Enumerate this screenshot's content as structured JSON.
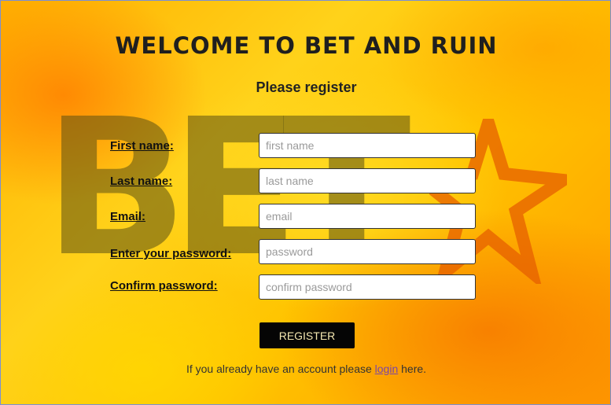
{
  "page": {
    "title": "WELCOME TO BET AND RUIN",
    "subtitle": "Please register",
    "watermark_text": "BET"
  },
  "form": {
    "fields": [
      {
        "label": "First name:",
        "placeholder": "first name",
        "value": ""
      },
      {
        "label": "Last name:",
        "placeholder": "last name",
        "value": ""
      },
      {
        "label": "Email:",
        "placeholder": "email",
        "value": ""
      },
      {
        "label": "Enter your password:",
        "placeholder": "password",
        "value": ""
      },
      {
        "label": "Confirm password:",
        "placeholder": "confirm password",
        "value": ""
      }
    ],
    "submit_label": "REGISTER"
  },
  "footer": {
    "prefix": "If you already have an account please ",
    "link": "login",
    "suffix": " here."
  },
  "colors": {
    "background_primary": "#ffc400",
    "background_accent": "#ff9a00",
    "button_bg": "#050505",
    "button_text": "#f3e6b0",
    "link": "#7a46a8"
  }
}
